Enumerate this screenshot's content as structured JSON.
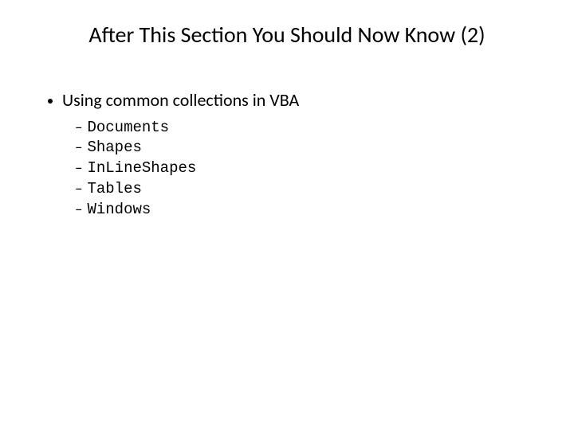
{
  "title": "After This Section You Should Now Know (2)",
  "bullet": "Using common collections in VBA",
  "subitems": [
    "Documents",
    "Shapes",
    "InLineShapes",
    "Tables",
    "Windows"
  ]
}
